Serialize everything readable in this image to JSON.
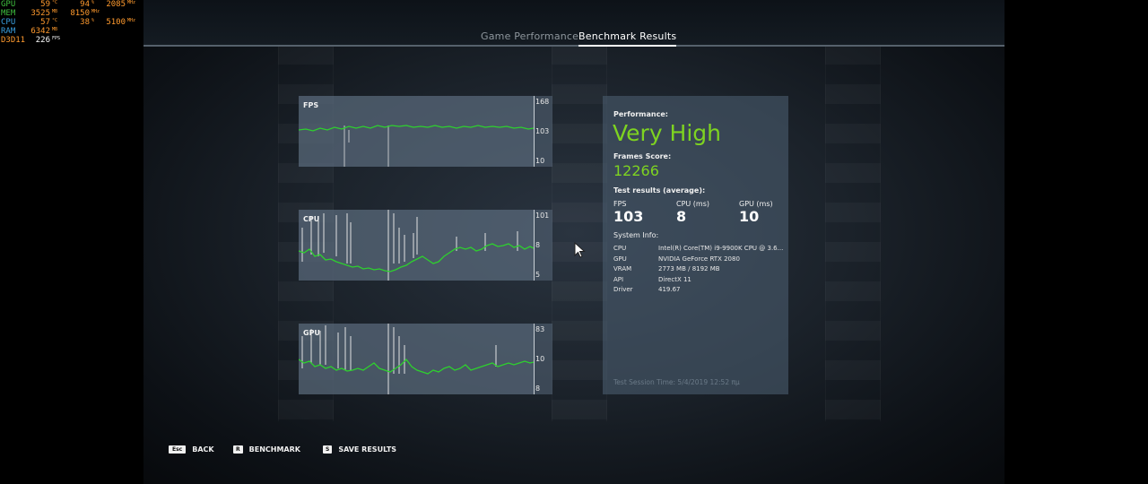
{
  "osd": {
    "rows": [
      {
        "label": "GPU",
        "color": "#3fbf3f",
        "v1": "59",
        "u1": "°C",
        "v2": "94",
        "u2": "%",
        "v3": "2085",
        "u3": "MHz"
      },
      {
        "label": "MEM",
        "color": "#3fbf3f",
        "v1": "3525",
        "u1": "MB",
        "v2": "8150",
        "u2": "MHz",
        "v3": "",
        "u3": ""
      },
      {
        "label": "CPU",
        "color": "#3aa0e0",
        "v1": "57",
        "u1": "°C",
        "v2": "38",
        "u2": "%",
        "v3": "5100",
        "u3": "MHz"
      },
      {
        "label": "RAM",
        "color": "#3aa0e0",
        "v1": "6342",
        "u1": "MB",
        "v2": "",
        "u2": "",
        "v3": "",
        "u3": ""
      },
      {
        "label": "D3D11",
        "color": "#ff9a2e",
        "v1": "226",
        "u1": "FPS",
        "v2": "",
        "u2": "",
        "v3": "",
        "u3": ""
      }
    ]
  },
  "tabs": {
    "inactive": "Game Performance",
    "active": "Benchmark Results"
  },
  "charts": {
    "fps": {
      "title": "FPS",
      "ticks": [
        "168",
        "103",
        "10"
      ]
    },
    "cpu": {
      "title": "CPU",
      "ticks": [
        "101",
        "8",
        "5"
      ]
    },
    "gpu": {
      "title": "GPU",
      "ticks": [
        "83",
        "10",
        "8"
      ]
    }
  },
  "panel": {
    "performance_label": "Performance:",
    "performance_value": "Very High",
    "frames_label": "Frames Score:",
    "frames_value": "12266",
    "test_label": "Test results (average):",
    "stats": [
      {
        "label": "FPS",
        "value": "103"
      },
      {
        "label": "CPU (ms)",
        "value": "8"
      },
      {
        "label": "GPU (ms)",
        "value": "10"
      }
    ],
    "sys_label": "System Info:",
    "sys": [
      {
        "k": "CPU",
        "v": "Intel(R) Core(TM) i9-9900K CPU @ 3.6..."
      },
      {
        "k": "GPU",
        "v": "NVIDIA GeForce RTX 2080"
      },
      {
        "k": "VRAM",
        "v": "2773 MB / 8192 MB"
      },
      {
        "k": "API",
        "v": "DirectX 11"
      },
      {
        "k": "Driver",
        "v": "419.67"
      }
    ],
    "session": "Test Session Time: 5/4/2019 12:52 πμ"
  },
  "footer": {
    "back_key": "Esc",
    "back": "BACK",
    "bench_key": "R",
    "bench": "BENCHMARK",
    "save_key": "S",
    "save": "SAVE RESULTS"
  },
  "colors": {
    "accent": "#7ed321",
    "line": "#2ed02e"
  }
}
